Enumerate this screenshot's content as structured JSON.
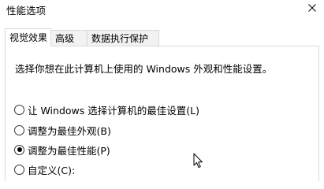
{
  "window": {
    "title": "性能选项"
  },
  "tabs": [
    {
      "label": "视觉效果",
      "active": true
    },
    {
      "label": "高级",
      "active": false
    },
    {
      "label": "数据执行保护",
      "active": false
    }
  ],
  "visual_effects": {
    "description": "选择你想在此计算机上使用的 Windows 外观和性能设置。",
    "options": [
      {
        "label": "让 Windows 选择计算机的最佳设置(L)",
        "checked": false
      },
      {
        "label": "调整为最佳外观(B)",
        "checked": false
      },
      {
        "label": "调整为最佳性能(P)",
        "checked": true
      },
      {
        "label": "自定义(C):",
        "checked": false
      }
    ]
  },
  "icons": {
    "close": "close-icon",
    "cursor": "mouse-pointer-icon"
  }
}
